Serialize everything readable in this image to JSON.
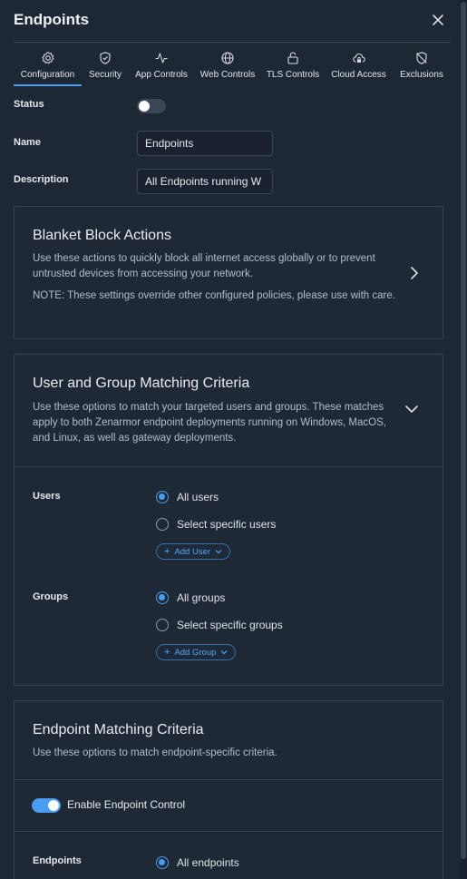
{
  "dialog": {
    "title": "Endpoints",
    "close_icon": "close-icon"
  },
  "tabs": [
    {
      "label": "Configuration",
      "icon": "gear-icon",
      "active": true
    },
    {
      "label": "Security",
      "icon": "shield-check-icon"
    },
    {
      "label": "App Controls",
      "icon": "activity-icon"
    },
    {
      "label": "Web Controls",
      "icon": "globe-icon"
    },
    {
      "label": "TLS Controls",
      "icon": "unlock-icon"
    },
    {
      "label": "Cloud Access",
      "icon": "cloud-lock-icon"
    },
    {
      "label": "Exclusions",
      "icon": "shield-off-icon"
    }
  ],
  "form": {
    "status_label": "Status",
    "status_enabled": false,
    "name_label": "Name",
    "name_value": "Endpoints",
    "description_label": "Description",
    "description_value": "All Endpoints running W"
  },
  "blanket": {
    "title": "Blanket Block Actions",
    "desc": "Use these actions to quickly block all internet access globally or to prevent untrusted devices from accessing your network.",
    "note": "NOTE: These settings override other configured policies, please use with care."
  },
  "user_group": {
    "title": "User and Group Matching Criteria",
    "desc": "Use these options to match your targeted users and groups. These matches apply to both Zenarmor endpoint deployments running on Windows, MacOS, and Linux, as well as gateway deployments.",
    "users_label": "Users",
    "users_all": "All users",
    "users_specific": "Select specific users",
    "add_user": "Add User",
    "groups_label": "Groups",
    "groups_all": "All groups",
    "groups_specific": "Select specific groups",
    "add_group": "Add Group"
  },
  "endpoint": {
    "title": "Endpoint Matching Criteria",
    "desc": "Use these options to match endpoint-specific criteria.",
    "control_label": "Enable Endpoint Control",
    "control_enabled": true,
    "endpoints_label": "Endpoints",
    "endpoints_all": "All endpoints"
  },
  "colors": {
    "accent": "#4a9cf0",
    "background": "#1e2734",
    "card_border": "#384251"
  }
}
